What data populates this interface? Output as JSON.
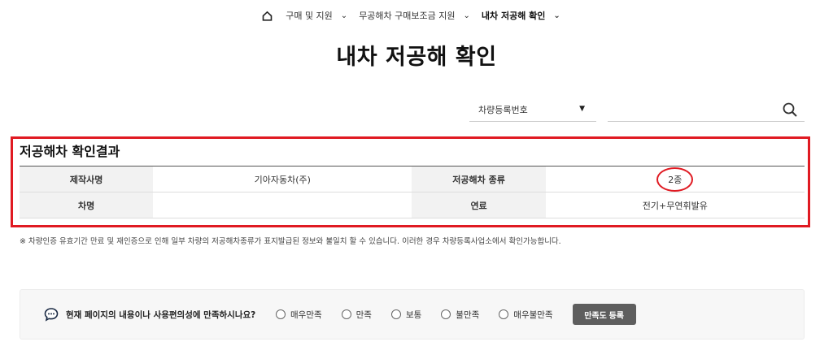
{
  "breadcrumb": {
    "items": [
      {
        "label": "구매 및 지원"
      },
      {
        "label": "무공해차 구매보조금 지원"
      },
      {
        "label": "내차 저공해 확인"
      }
    ]
  },
  "page_title": "내차 저공해 확인",
  "search": {
    "select_value": "차량등록번호",
    "input_value": "",
    "input_placeholder": ""
  },
  "result": {
    "title": "저공해차 확인결과",
    "rows": [
      {
        "h1": "제작사명",
        "v1": "기아자동차(주)",
        "h2": "저공해차 종류",
        "v2": "2종"
      },
      {
        "h1": "차명",
        "v1": "",
        "h2": "연료",
        "v2": "전기+무연휘발유"
      }
    ]
  },
  "notice": "※ 차량인증 유효기간 만료 및 재인증으로 인해 일부 차량의 저공해차종류가 표지발급된 정보와 불일치 할 수 있습니다. 이러한 경우 차량등록사업소에서 확인가능합니다.",
  "survey": {
    "question": "현재 페이지의 내용이나 사용편의성에 만족하시나요?",
    "options": [
      "매우만족",
      "만족",
      "보통",
      "불만족",
      "매우불만족"
    ],
    "submit_label": "만족도 등록"
  },
  "colors": {
    "highlight": "#e01a22",
    "button": "#5e5e5e"
  }
}
